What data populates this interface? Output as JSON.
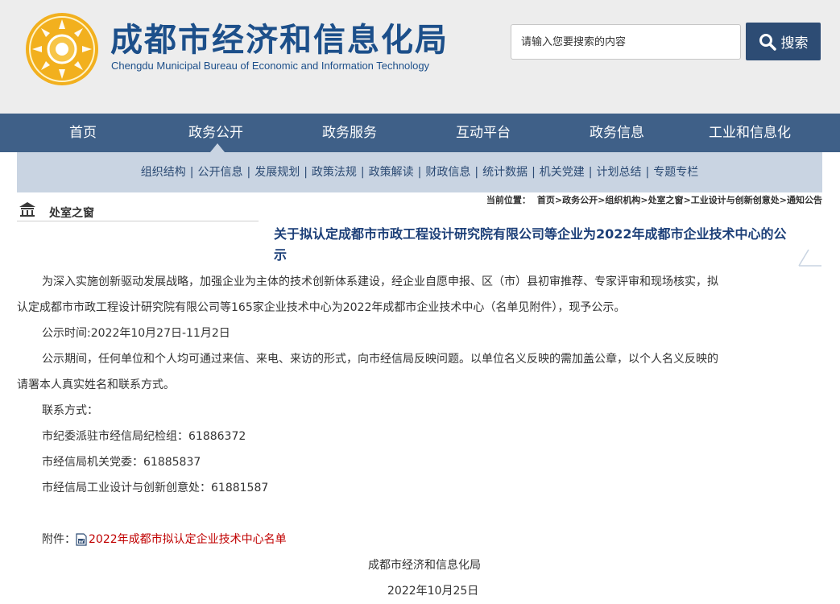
{
  "header": {
    "org_name_cn": "成都市经济和信息化局",
    "org_name_en": "Chengdu Municipal Bureau of Economic and Information Technology",
    "search_placeholder": "请输入您要搜索的内容",
    "search_button": "搜索",
    "logo_icon": "sun-emblem-logo",
    "accent_color": "#1c4f8a"
  },
  "nav": {
    "items": [
      "首页",
      "政务公开",
      "政务服务",
      "互动平台",
      "政务信息",
      "工业和信息化"
    ],
    "active": "政务公开",
    "bg_color": "#3f6088"
  },
  "subnav": {
    "items": [
      "组织结构",
      "公开信息",
      "发展规划",
      "政策法规",
      "政策解读",
      "财政信息",
      "统计数据",
      "机关党建",
      "计划总结",
      "专题专栏"
    ],
    "separator": "|"
  },
  "section": {
    "title": "处室之窗",
    "icon": "building-icon"
  },
  "breadcrumb": {
    "label": "当前位置：",
    "items": [
      "首页",
      "政务公开",
      "组织机构",
      "处室之窗",
      "工业设计与创新创意处",
      "通知公告"
    ],
    "separator": ">"
  },
  "article": {
    "title": "关于拟认定成都市市政工程设计研究院有限公司等企业为2022年成都市企业技术中心的公示",
    "para1_line1": "为深入实施创新驱动发展战略，加强企业为主体的技术创新体系建设，经企业自愿申报、区（市）县初审推荐、专家评审和现场核实，拟",
    "para1_line2": "认定成都市市政工程设计研究院有限公司等165家企业技术中心为2022年成都市企业技术中心（名单见附件），现予公示。",
    "period": "公示时间:2022年10月27日-11月2日",
    "para3_line1": "公示期间，任何单位和个人均可通过来信、来电、来访的形式，向市经信局反映问题。以单位名义反映的需加盖公章，以个人名义反映的",
    "para3_line2": "请署本人真实姓名和联系方式。",
    "contact_label": "联系方式：",
    "contact1": "市纪委派驻市经信局纪检组：61886372",
    "contact2": "市经信局机关党委：61885837",
    "contact3": "市经信局工业设计与创新创意处：61881587",
    "attachment_label": "附件：",
    "attachment_icon": "document-icon",
    "attachment_link": "2022年成都市拟认定企业技术中心名单",
    "signature": "成都市经济和信息化局",
    "date": "2022年10月25日"
  }
}
